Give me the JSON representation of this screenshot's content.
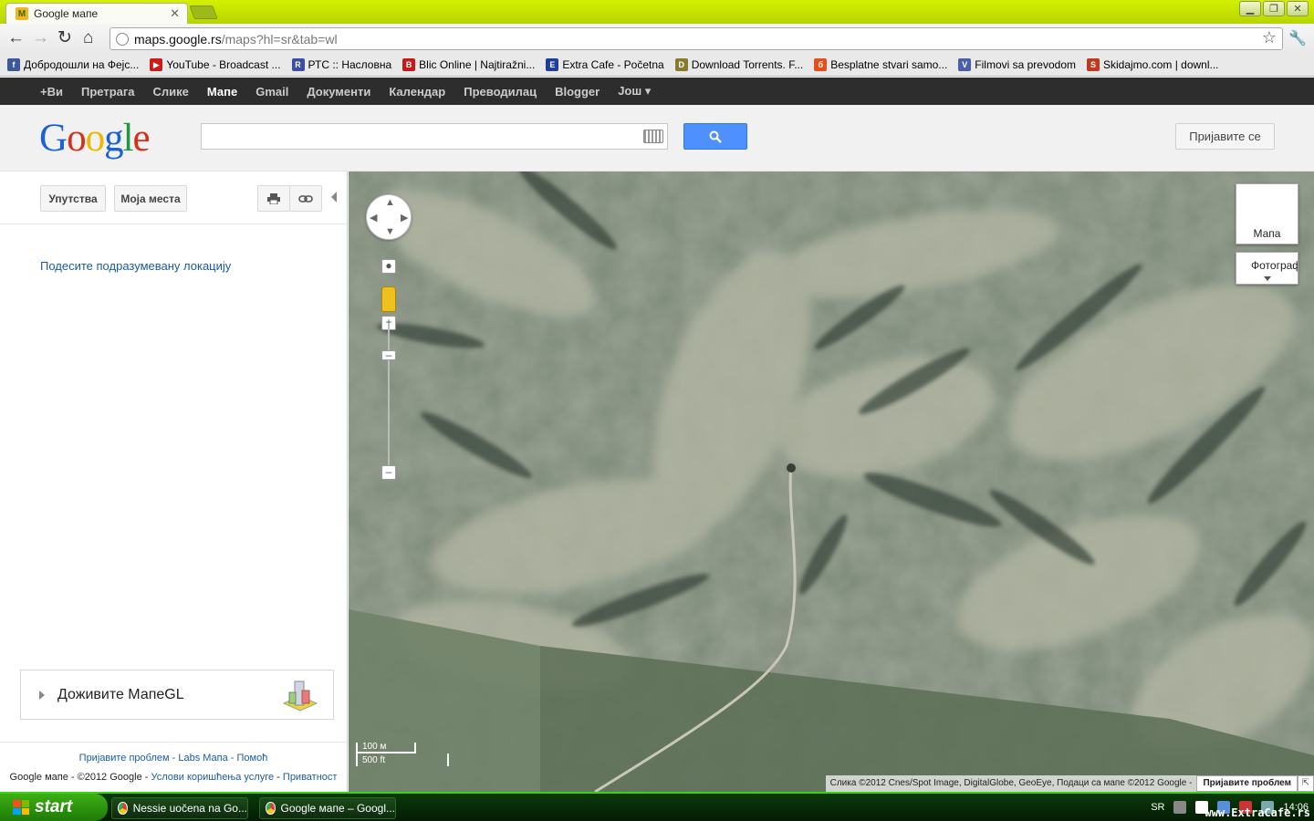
{
  "browser": {
    "tab_title": "Google мапе",
    "url_host": "maps.google.rs",
    "url_path": "/maps?hl=sr&tab=wl"
  },
  "bookmarks": [
    {
      "label": "Добродошли на Фејс...",
      "color": "#3b5998",
      "glyph": "f"
    },
    {
      "label": "YouTube - Broadcast ...",
      "color": "#cc1b1b",
      "glyph": "▶"
    },
    {
      "label": "РТС :: Насловна",
      "color": "#3a4fa0",
      "glyph": "R"
    },
    {
      "label": "Blic Online | Najtiražni...",
      "color": "#c61a1a",
      "glyph": "B"
    },
    {
      "label": "Extra Cafe - Početna",
      "color": "#1f3d9c",
      "glyph": "E"
    },
    {
      "label": "Download Torrents. F...",
      "color": "#8a7a30",
      "glyph": "D"
    },
    {
      "label": "Besplatne stvari samo...",
      "color": "#e3501c",
      "glyph": "б"
    },
    {
      "label": "Filmovi sa prevodom",
      "color": "#4b5fa8",
      "glyph": "V"
    },
    {
      "label": "Skidajmo.com | downl...",
      "color": "#c0391d",
      "glyph": "S"
    }
  ],
  "gbar": [
    "+Ви",
    "Претрага",
    "Слике",
    "Мапе",
    "Gmail",
    "Документи",
    "Календар",
    "Преводилац",
    "Blogger",
    "Још ▾"
  ],
  "header": {
    "logo": "Google",
    "signin": "Пријавите се"
  },
  "panel": {
    "directions": "Упутства",
    "my_places": "Моја места",
    "default_location": "Подесите подразумевану локацију",
    "promo": "Доживите МапеGL",
    "footer_links": [
      "Пријавите проблем",
      "Labs Мапа",
      "Помоћ"
    ],
    "footer_copy": "Google мапе - ©2012 Google - ",
    "footer_links2": [
      "Услови коришћења услуге",
      "Приватност"
    ]
  },
  "map": {
    "map_button": "Мапа",
    "photo_button": "Фотограф",
    "scale_metric": "100 м",
    "scale_imperial": "500 ft",
    "attribution": "Слика ©2012 Cnes/Spot Image, DigitalGlobe, GeoEye, Подаци са мапе ©2012 Google -",
    "report": "Пријавите проблем"
  },
  "taskbar": {
    "start": "start",
    "tasks": [
      "Nessie uočena na Go...",
      "Google мапе – Googl..."
    ],
    "lang": "SR",
    "clock": "14:06",
    "watermark": "www.ExtraCafe.rs"
  }
}
